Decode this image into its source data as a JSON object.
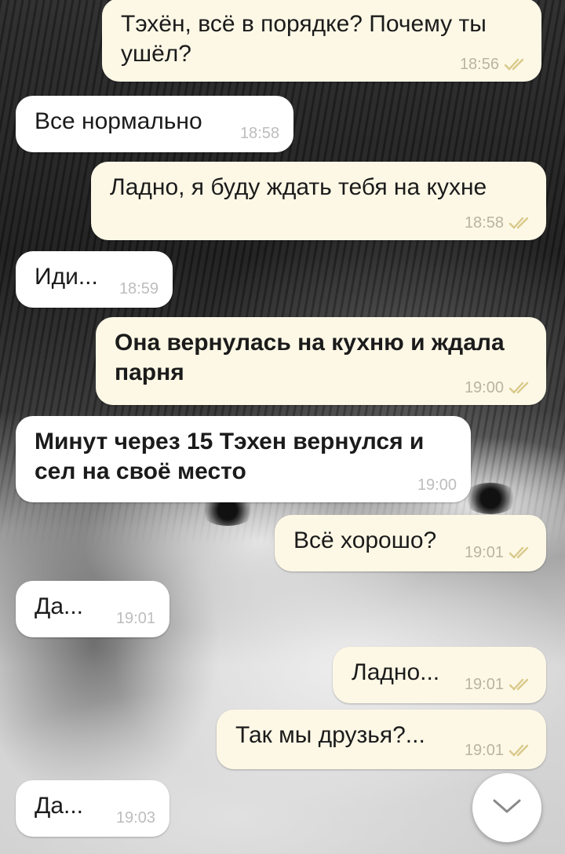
{
  "messages": [
    {
      "dir": "out",
      "text": "Тэхён, всё в порядке? Почему ты ушёл?",
      "time": "18:56",
      "read": true,
      "bold": false
    },
    {
      "dir": "in",
      "text": "Все нормально",
      "time": "18:58",
      "bold": false
    },
    {
      "dir": "out",
      "text": "Ладно, я буду ждать тебя на кухне",
      "time": "18:58",
      "read": true,
      "bold": false
    },
    {
      "dir": "in",
      "text": "Иди...",
      "time": "18:59",
      "bold": false
    },
    {
      "dir": "out",
      "text": "Она вернулась на кухню и ждала парня",
      "time": "19:00",
      "read": true,
      "bold": true
    },
    {
      "dir": "in",
      "text": "Минут через 15 Тэхен вернулся и сел на своё место",
      "time": "19:00",
      "bold": true
    },
    {
      "dir": "out",
      "text": "Всё хорошо?",
      "time": "19:01",
      "read": true,
      "bold": false
    },
    {
      "dir": "in",
      "text": "Да...",
      "time": "19:01",
      "bold": false
    },
    {
      "dir": "out",
      "text": "Ладно...",
      "time": "19:01",
      "read": true,
      "bold": false
    },
    {
      "dir": "out",
      "text": "Так мы друзья?...",
      "time": "19:01",
      "read": true,
      "bold": false
    },
    {
      "dir": "in",
      "text": "Да...",
      "time": "19:03",
      "bold": false
    }
  ],
  "icons": {
    "read_receipt": "double-check-icon",
    "scroll_down": "chevron-down-icon"
  },
  "colors": {
    "outgoing_bubble": "#fdf8e6",
    "incoming_bubble": "#ffffff",
    "timestamp": "#b8b3a3",
    "check": "#d9c98a"
  }
}
